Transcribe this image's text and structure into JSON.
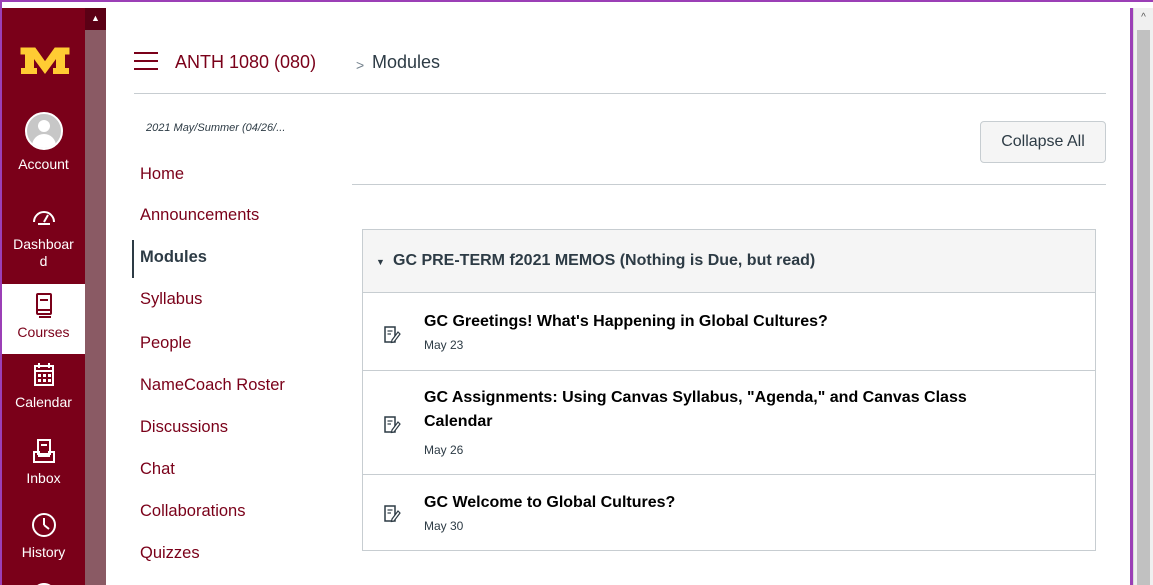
{
  "global_nav": {
    "logo": "university-m-logo",
    "items": [
      {
        "label": "Account",
        "icon": "user-avatar-icon"
      },
      {
        "label": "Dashboard",
        "label_line1": "Dashboar",
        "label_line2": "d",
        "icon": "dashboard-gauge-icon"
      },
      {
        "label": "Courses",
        "icon": "book-icon",
        "active": true
      },
      {
        "label": "Calendar",
        "icon": "calendar-icon"
      },
      {
        "label": "Inbox",
        "icon": "inbox-icon"
      },
      {
        "label": "History",
        "icon": "clock-icon"
      }
    ]
  },
  "breadcrumb": {
    "course": "ANTH 1080 (080)",
    "separator": ">",
    "page": "Modules"
  },
  "term_label": "2021 May/Summer (04/26/...",
  "course_nav": [
    {
      "label": "Home"
    },
    {
      "label": "Announcements"
    },
    {
      "label": "Modules",
      "active": true
    },
    {
      "label": "Syllabus"
    },
    {
      "label": "People"
    },
    {
      "label": "NameCoach Roster"
    },
    {
      "label": "Discussions"
    },
    {
      "label": "Chat"
    },
    {
      "label": "Collaborations"
    },
    {
      "label": "Quizzes"
    }
  ],
  "toolbar": {
    "collapse_all": "Collapse All"
  },
  "module": {
    "title": "GC PRE-TERM f2021 MEMOS (Nothing is Due, but read)",
    "items": [
      {
        "title": "GC Greetings! What's Happening in Global Cultures?",
        "date": "May 23",
        "icon": "assignment-icon"
      },
      {
        "title": "GC Assignments: Using Canvas Syllabus, \"Agenda,\" and Canvas Class Calendar",
        "date": "May 26",
        "icon": "assignment-icon"
      },
      {
        "title": "GC Welcome to Global Cultures?",
        "date": "May 30",
        "icon": "assignment-icon"
      }
    ]
  },
  "colors": {
    "brand": "#7a0019",
    "brand_gold": "#ffcc33",
    "frame": "#9b3fb6"
  }
}
